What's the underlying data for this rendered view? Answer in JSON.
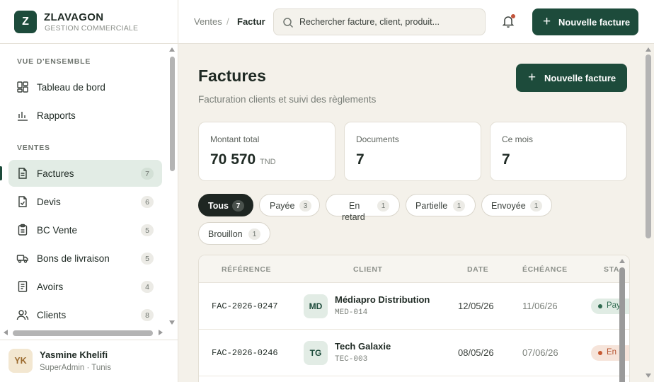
{
  "brand": {
    "initial": "Z",
    "name": "ZLAVAGON",
    "subtitle": "GESTION COMMERCIALE"
  },
  "sidebar": {
    "sections": [
      {
        "label": "VUE D'ENSEMBLE"
      },
      {
        "label": "VENTES"
      }
    ],
    "items": [
      {
        "label": "Tableau de bord",
        "icon": "dashboard-icon"
      },
      {
        "label": "Rapports",
        "icon": "bar-chart-icon"
      },
      {
        "label": "Factures",
        "icon": "invoice-icon",
        "count": "7",
        "active": true
      },
      {
        "label": "Devis",
        "icon": "quote-icon",
        "count": "6"
      },
      {
        "label": "BC Vente",
        "icon": "clipboard-icon",
        "count": "5"
      },
      {
        "label": "Bons de livraison",
        "icon": "truck-icon",
        "count": "5"
      },
      {
        "label": "Avoirs",
        "icon": "credit-note-icon",
        "count": "4"
      },
      {
        "label": "Clients",
        "icon": "users-icon",
        "count": "8"
      }
    ]
  },
  "user": {
    "initials": "YK",
    "name": "Yasmine Khelifi",
    "role": "SuperAdmin · Tunis"
  },
  "topbar": {
    "breadcrumb": [
      "Ventes",
      "/",
      "Factur"
    ],
    "search_placeholder": "Rechercher facture, client, produit...",
    "new_invoice_label": "Nouvelle facture"
  },
  "page": {
    "title": "Factures",
    "subtitle": "Facturation clients et suivi des règlements",
    "new_invoice_label": "Nouvelle facture"
  },
  "stats": [
    {
      "label": "Montant total",
      "value": "70 570",
      "unit": "TND"
    },
    {
      "label": "Documents",
      "value": "7"
    },
    {
      "label": "Ce mois",
      "value": "7"
    }
  ],
  "filters": [
    {
      "label": "Tous",
      "count": "7",
      "active": true
    },
    {
      "label": "Payée",
      "count": "3"
    },
    {
      "label_line1": "En",
      "label_line2": "retard",
      "count": "1"
    },
    {
      "label": "Partielle",
      "count": "1"
    },
    {
      "label": "Envoyée",
      "count": "1"
    },
    {
      "label": "Brouillon",
      "count": "1"
    }
  ],
  "table": {
    "headers": [
      "RÉFÉRENCE",
      "CLIENT",
      "DATE",
      "ÉCHÉANCE",
      "STA"
    ],
    "rows": [
      {
        "ref": "FAC-2026-0247",
        "initials": "MD",
        "client": "Médiapro Distribution",
        "code": "MED-014",
        "date": "12/05/26",
        "due": "11/06/26",
        "status": "Pay"
      },
      {
        "ref": "FAC-2026-0246",
        "initials": "TG",
        "client": "Tech Galaxie",
        "code": "TEC-003",
        "date": "08/05/26",
        "due": "07/06/26",
        "status": "En"
      }
    ]
  },
  "colors": {
    "primary": "#1d4b3b",
    "active_bg": "#e2ece5",
    "paid": "#2f6a4f",
    "late": "#c65a33"
  }
}
